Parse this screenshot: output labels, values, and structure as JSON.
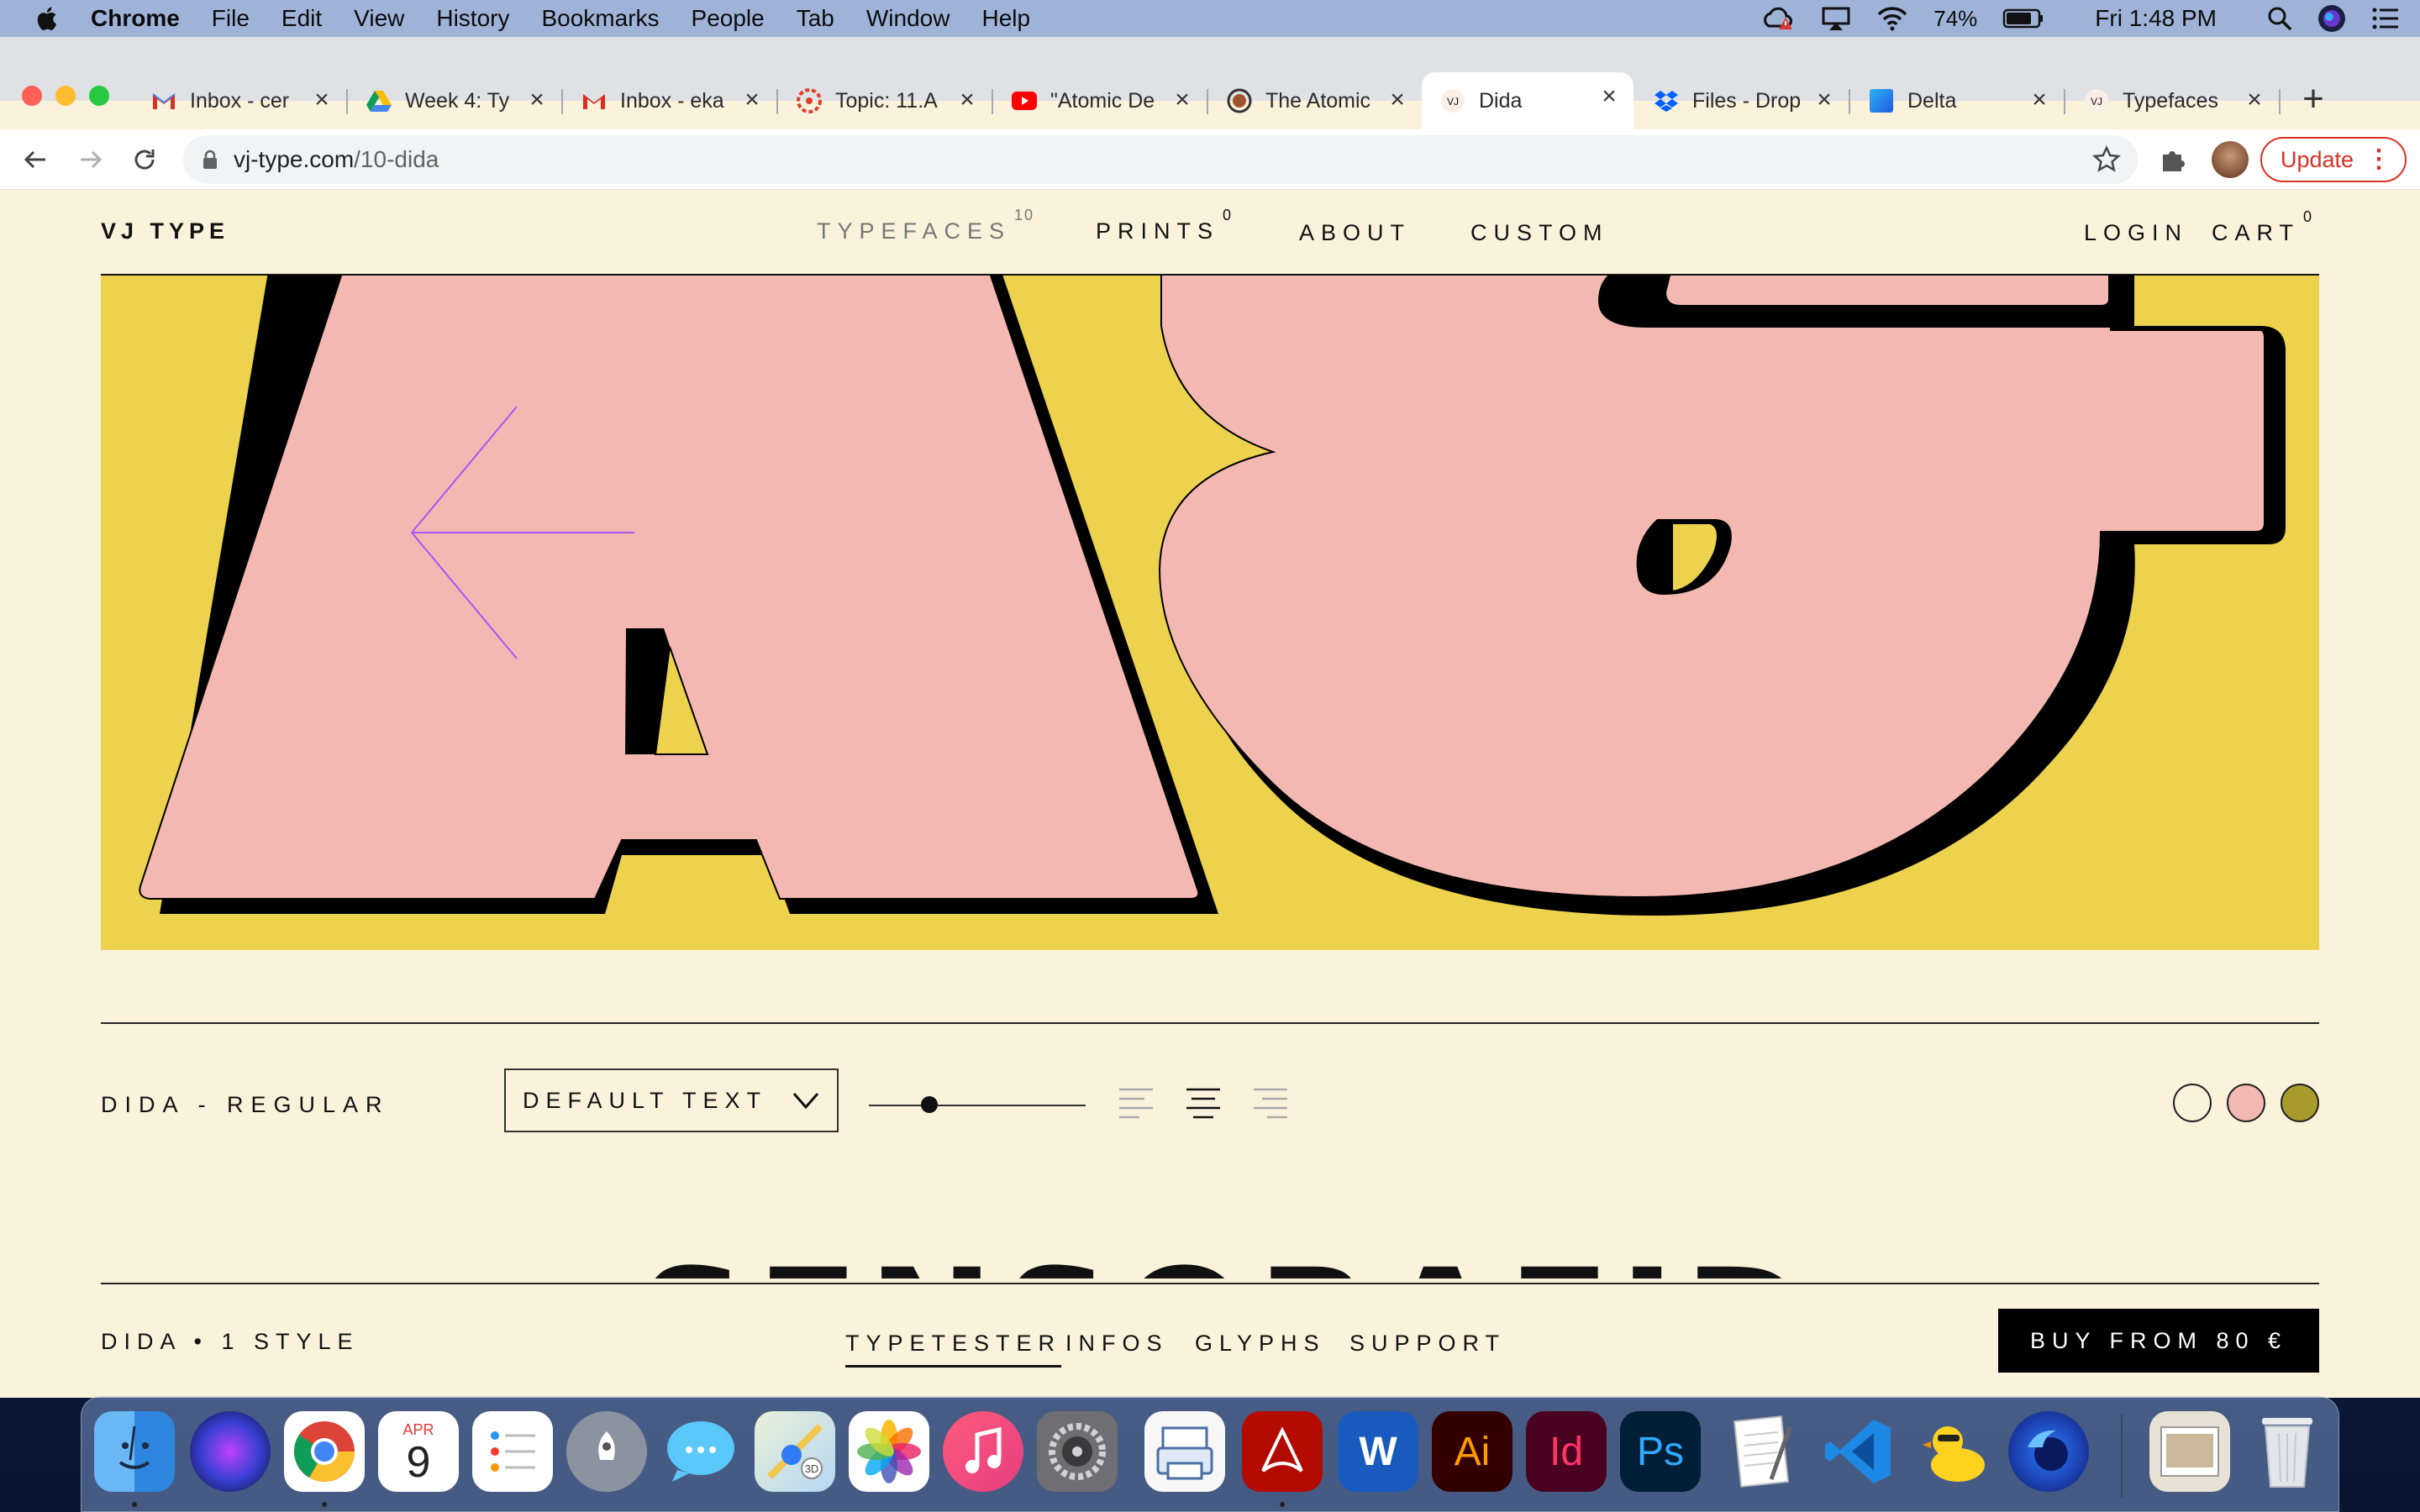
{
  "menubar": {
    "app": "Chrome",
    "items": [
      "File",
      "Edit",
      "View",
      "History",
      "Bookmarks",
      "People",
      "Tab",
      "Window",
      "Help"
    ],
    "battery": "74%",
    "clock": "Fri 1:48 PM"
  },
  "tabs": [
    {
      "title": "Inbox - cer",
      "icon": "gmail-icon"
    },
    {
      "title": "Week 4: Ty",
      "icon": "google-drive-icon"
    },
    {
      "title": "Inbox - eka",
      "icon": "gmail-icon"
    },
    {
      "title": "Topic: 11.A",
      "icon": "canvas-icon"
    },
    {
      "title": "\"Atomic De",
      "icon": "youtube-icon"
    },
    {
      "title": "The Atomic",
      "icon": "site-icon"
    },
    {
      "title": "Dida",
      "icon": "vj-icon",
      "active": true
    },
    {
      "title": "Files - Drop",
      "icon": "dropbox-icon"
    },
    {
      "title": "Delta",
      "icon": "delta-icon"
    },
    {
      "title": "Typefaces",
      "icon": "vj-icon"
    }
  ],
  "toolbar": {
    "url_host": "vj-type.com",
    "url_path": "/10-dida",
    "update_label": "Update"
  },
  "site": {
    "logo": "VJ TYPE",
    "nav": [
      {
        "label": "TYPEFACES",
        "count": "10"
      },
      {
        "label": "PRINTS",
        "count": "0"
      },
      {
        "label": "ABOUT",
        "count": ""
      },
      {
        "label": "CUSTOM",
        "count": ""
      }
    ],
    "login": "LOGIN",
    "cart": "CART",
    "cart_count": "0"
  },
  "typetester": {
    "style_label": "DIDA - REGULAR",
    "dropdown_value": "DEFAULT TEXT",
    "size_fraction": 0.28,
    "swatches": [
      "#fbf2dc",
      "#f4b8b2",
      "#a99a2c"
    ],
    "sample_text": "SENSORAFID"
  },
  "footer_bar": {
    "family_label": "DIDA • 1 STYLE",
    "tabs": [
      "TYPETESTER",
      "INFOS",
      "GLYPHS",
      "SUPPORT"
    ],
    "buy_label": "BUY FROM 80 €"
  },
  "colors": {
    "page_bg": "#fbf2dc",
    "hero_bg": "#ecd24d",
    "glyph_pink": "#f4b8b2",
    "accent_purple": "#a855f7"
  },
  "dock": [
    "Finder",
    "Siri",
    "Chrome",
    "Calendar",
    "Reminders",
    "Launchpad",
    "Messages",
    "Maps",
    "Photos",
    "Music",
    "System Preferences",
    "Printer",
    "Acrobat",
    "Word",
    "Illustrator",
    "InDesign",
    "Photoshop",
    "TextEdit",
    "VS Code",
    "Cyberduck",
    "Firefox Developer",
    "Screenshot",
    "Trash"
  ],
  "calendar": {
    "month": "APR",
    "day": "9"
  }
}
